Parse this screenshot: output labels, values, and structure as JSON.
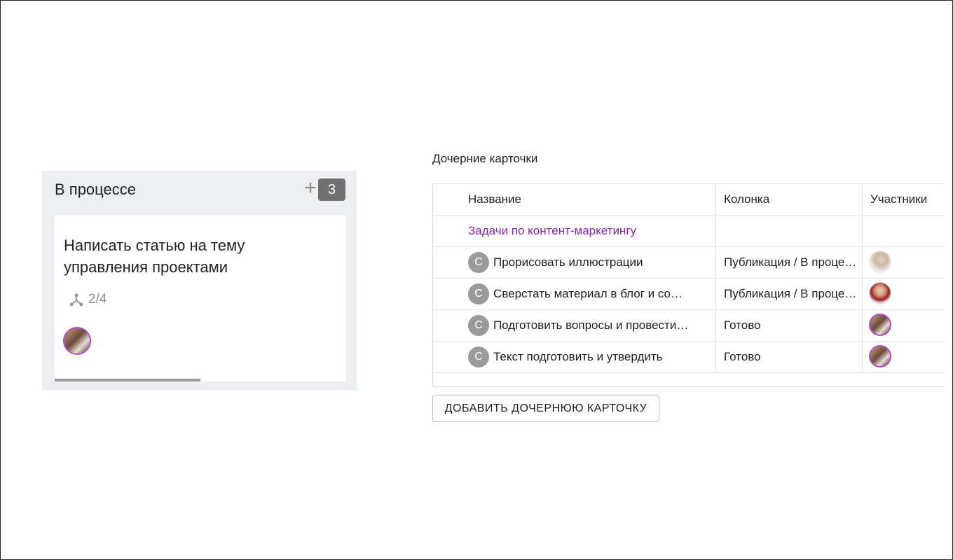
{
  "column": {
    "title": "В процессе",
    "add_label": "+",
    "count": "3",
    "card": {
      "title": "Написать статью на тему управления проектами",
      "subtasks": "2/4",
      "progress": 0.5
    }
  },
  "child_cards": {
    "title": "Дочерние карточки",
    "headers": {
      "name": "Название",
      "column": "Колонка",
      "members": "Участники"
    },
    "group_link": "Задачи по контент-маркетингу",
    "rows": [
      {
        "badge": "С",
        "name": "Прорисовать иллюстрации",
        "column": "Публикация / В процессе"
      },
      {
        "badge": "С",
        "name": "Сверстать материал в блог и соцсети",
        "column": "Публикация / В процессе"
      },
      {
        "badge": "С",
        "name": "Подготовить вопросы и провести интервью",
        "column": "Готово"
      },
      {
        "badge": "С",
        "name": "Текст подготовить и утвердить",
        "column": "Готово"
      }
    ],
    "add_button": "ДОБАВИТЬ ДОЧЕРНЮЮ КАРТОЧКУ"
  },
  "colors": {
    "accent": "#8e24aa",
    "badge": "#707070",
    "avatar_ring": "#b14fc5"
  }
}
